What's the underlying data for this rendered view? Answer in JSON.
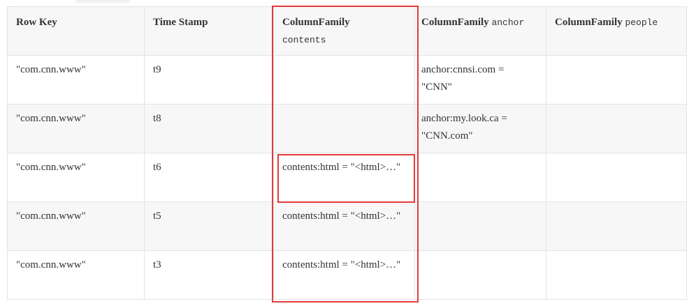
{
  "table": {
    "headers": {
      "row_key": "Row Key",
      "time_stamp": "Time Stamp",
      "cf_contents_label": "ColumnFamily",
      "cf_contents_name": "contents",
      "cf_anchor_label": "ColumnFamily",
      "cf_anchor_name": "anchor",
      "cf_people_label": "ColumnFamily",
      "cf_people_name": "people"
    },
    "rows": [
      {
        "row_key": "\"com.cnn.www\"",
        "time_stamp": "t9",
        "contents": "",
        "anchor": "anchor:cnnsi.com = \"CNN\"",
        "people": ""
      },
      {
        "row_key": "\"com.cnn.www\"",
        "time_stamp": "t8",
        "contents": "",
        "anchor": "anchor:my.look.ca = \"CNN.com\"",
        "people": ""
      },
      {
        "row_key": "\"com.cnn.www\"",
        "time_stamp": "t6",
        "contents": "contents:html = \"<html>…\"",
        "anchor": "",
        "people": ""
      },
      {
        "row_key": "\"com.cnn.www\"",
        "time_stamp": "t5",
        "contents": "contents:html = \"<html>…\"",
        "anchor": "",
        "people": ""
      },
      {
        "row_key": "\"com.cnn.www\"",
        "time_stamp": "t3",
        "contents": "contents:html = \"<html>…\"",
        "anchor": "",
        "people": ""
      }
    ]
  },
  "colors": {
    "highlight": "#e23b3b",
    "header_bg": "#f7f7f7",
    "alt_row_bg": "#f7f7f7",
    "border": "#e3e3e3"
  }
}
